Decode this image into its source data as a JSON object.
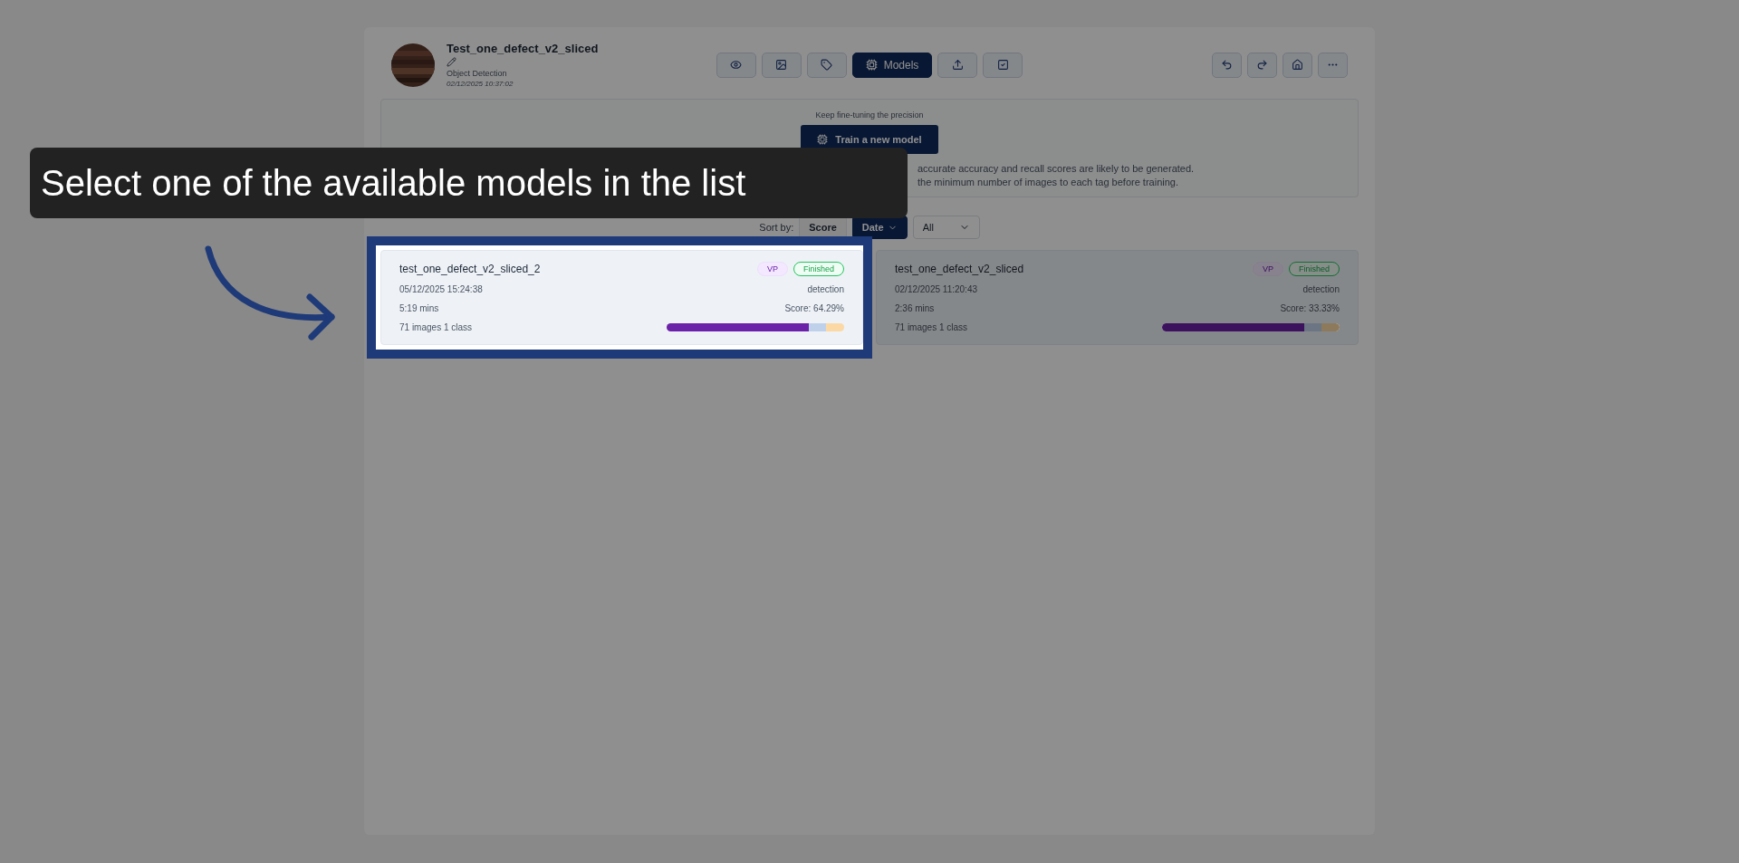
{
  "project": {
    "title": "Test_one_defect_v2_sliced",
    "type": "Object Detection",
    "date": "02/12/2025 10:37:02"
  },
  "toolbar": [
    {
      "selected": false
    },
    {
      "selected": false
    },
    {
      "selected": false
    },
    {
      "label": "Models",
      "selected": true
    },
    {
      "selected": false
    },
    {
      "selected": false
    }
  ],
  "training_panel": {
    "hint": "Keep fine-tuning the precision",
    "button": "Train a new model",
    "notes": [
      "accurate accuracy and recall scores are likely to be generated.",
      "the minimum number of images to each tag before training."
    ]
  },
  "sort": {
    "label": "Sort by:",
    "options": [
      {
        "label": "Score",
        "selected": false
      },
      {
        "label": "Date",
        "selected": true
      }
    ],
    "filter": "All"
  },
  "models": [
    {
      "name": "test_one_defect_v2_sliced_2",
      "badge": "VP",
      "status": "Finished",
      "date": "05/12/2025 15:24:38",
      "task": "detection",
      "duration": "5:19 mins",
      "score": "Score: 64.29%",
      "summary": "71 images 1 class",
      "highlighted": true,
      "level": 0.8,
      "segments": [
        {
          "color": "#6b21a8"
        },
        {
          "color": "#bfd1ea"
        },
        {
          "color": "#fcd9a4"
        }
      ]
    },
    {
      "name": "test_one_defect_v2_sliced",
      "badge": "VP",
      "status": "Finished",
      "date": "02/12/2025 11:20:43",
      "task": "detection",
      "duration": "2:36 mins",
      "score": "Score: 33.33%",
      "summary": "71 images 1 class",
      "highlighted": false,
      "level": 0.8,
      "segments": [
        {
          "color": "#3c125e"
        },
        {
          "color": "#6b7583"
        },
        {
          "color": "#8d7a5c"
        }
      ]
    }
  ],
  "tooltip": "Select one of the available models in the list"
}
